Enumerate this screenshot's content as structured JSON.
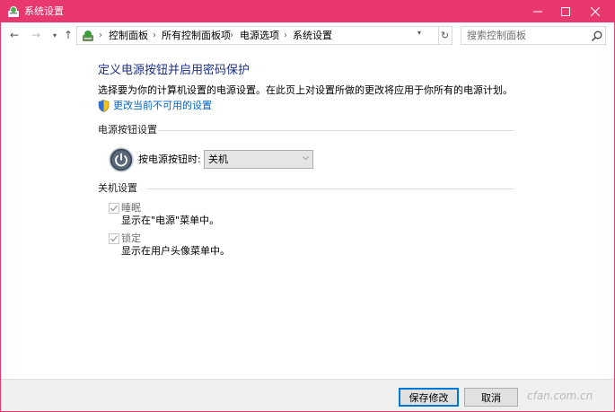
{
  "window": {
    "title": "系统设置",
    "controls": {
      "minimize": "—",
      "maximize": "☐",
      "close": "✕"
    }
  },
  "nav": {
    "back": "←",
    "forward": "→",
    "history": "▾",
    "up": "↑",
    "breadcrumbs": [
      "控制面板",
      "所有控制面板项",
      "电源选项",
      "系统设置"
    ],
    "separator": "›",
    "address_dropdown": "▾",
    "refresh": "↻",
    "search_placeholder": "搜索控制面板"
  },
  "main": {
    "title": "定义电源按钮并启用密码保护",
    "description": "选择要为你的计算机设置的电源设置。在此页上对设置所做的更改将应用于你所有的电源计划。",
    "change_link": "更改当前不可用的设置",
    "power_group": {
      "title": "电源按钮设置",
      "label": "按电源按钮时:",
      "selected": "关机",
      "arrow": "⌵"
    },
    "shutdown_group": {
      "title": "关机设置",
      "items": [
        {
          "label": "睡眠",
          "description": "显示在\"电源\"菜单中。",
          "checked": true
        },
        {
          "label": "锁定",
          "description": "显示在用户头像菜单中。",
          "checked": true
        }
      ]
    }
  },
  "footer": {
    "save": "保存修改",
    "cancel": "取消",
    "watermark": "cfan.com.cn"
  },
  "colors": {
    "titlebar": "#e8386d",
    "title_text": "#1e3287",
    "link": "#0066cc",
    "accent_button": "#0078d7"
  }
}
